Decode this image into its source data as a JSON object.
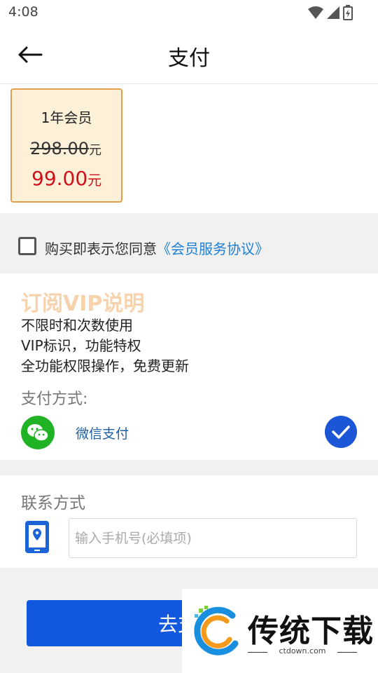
{
  "status_bar": {
    "time": "4:08"
  },
  "header": {
    "title": "支付",
    "back_icon": "arrow-left-icon"
  },
  "plan": {
    "name": "1年会员",
    "original_price": "298.00",
    "price": "99.00",
    "currency_unit": "元",
    "selected": true
  },
  "agreement": {
    "checked": false,
    "text": "购买即表示您同意",
    "link": "《会员服务协议》"
  },
  "vip": {
    "title": "订阅VIP说明",
    "lines": [
      "不限时和次数使用",
      "VIP标识，功能特权",
      "全功能权限操作，免费更新"
    ]
  },
  "payment": {
    "label": "支付方式:",
    "method": "微信支付",
    "selected": true
  },
  "contact": {
    "label": "联系方式",
    "phone_placeholder": "输入手机号(必填项)",
    "phone_value": ""
  },
  "submit": {
    "label": "去支"
  },
  "watermark": {
    "brand": "传统下载",
    "domain": "ctdown.com"
  },
  "colors": {
    "accent_blue": "#1258de",
    "price_red": "#d0101a",
    "plan_border": "#e0a04a",
    "plan_bg": "#fdf0d8",
    "wechat_green": "#21b326",
    "link_blue": "#1e7fd6",
    "vip_title": "#f6d3ad"
  }
}
